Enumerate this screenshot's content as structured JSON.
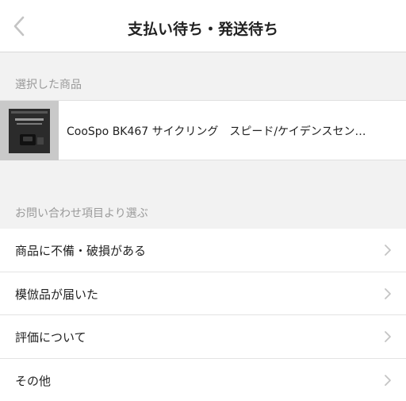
{
  "header": {
    "title": "支払い待ち・発送待ち"
  },
  "selected_section": {
    "label": "選択した商品",
    "product": {
      "name": "CooSpo BK467 サイクリング　スピード/ケイデンスセン…"
    }
  },
  "inquiry_section": {
    "label": "お問い合わせ項目より選ぶ",
    "items": [
      {
        "label": "商品に不備・破損がある"
      },
      {
        "label": "模倣品が届いた"
      },
      {
        "label": "評価について"
      },
      {
        "label": "その他"
      }
    ]
  },
  "colors": {
    "background": "#f2f2f2",
    "surface": "#ffffff",
    "muted_text": "#9a9a9a",
    "chevron": "#c4c4c4"
  }
}
